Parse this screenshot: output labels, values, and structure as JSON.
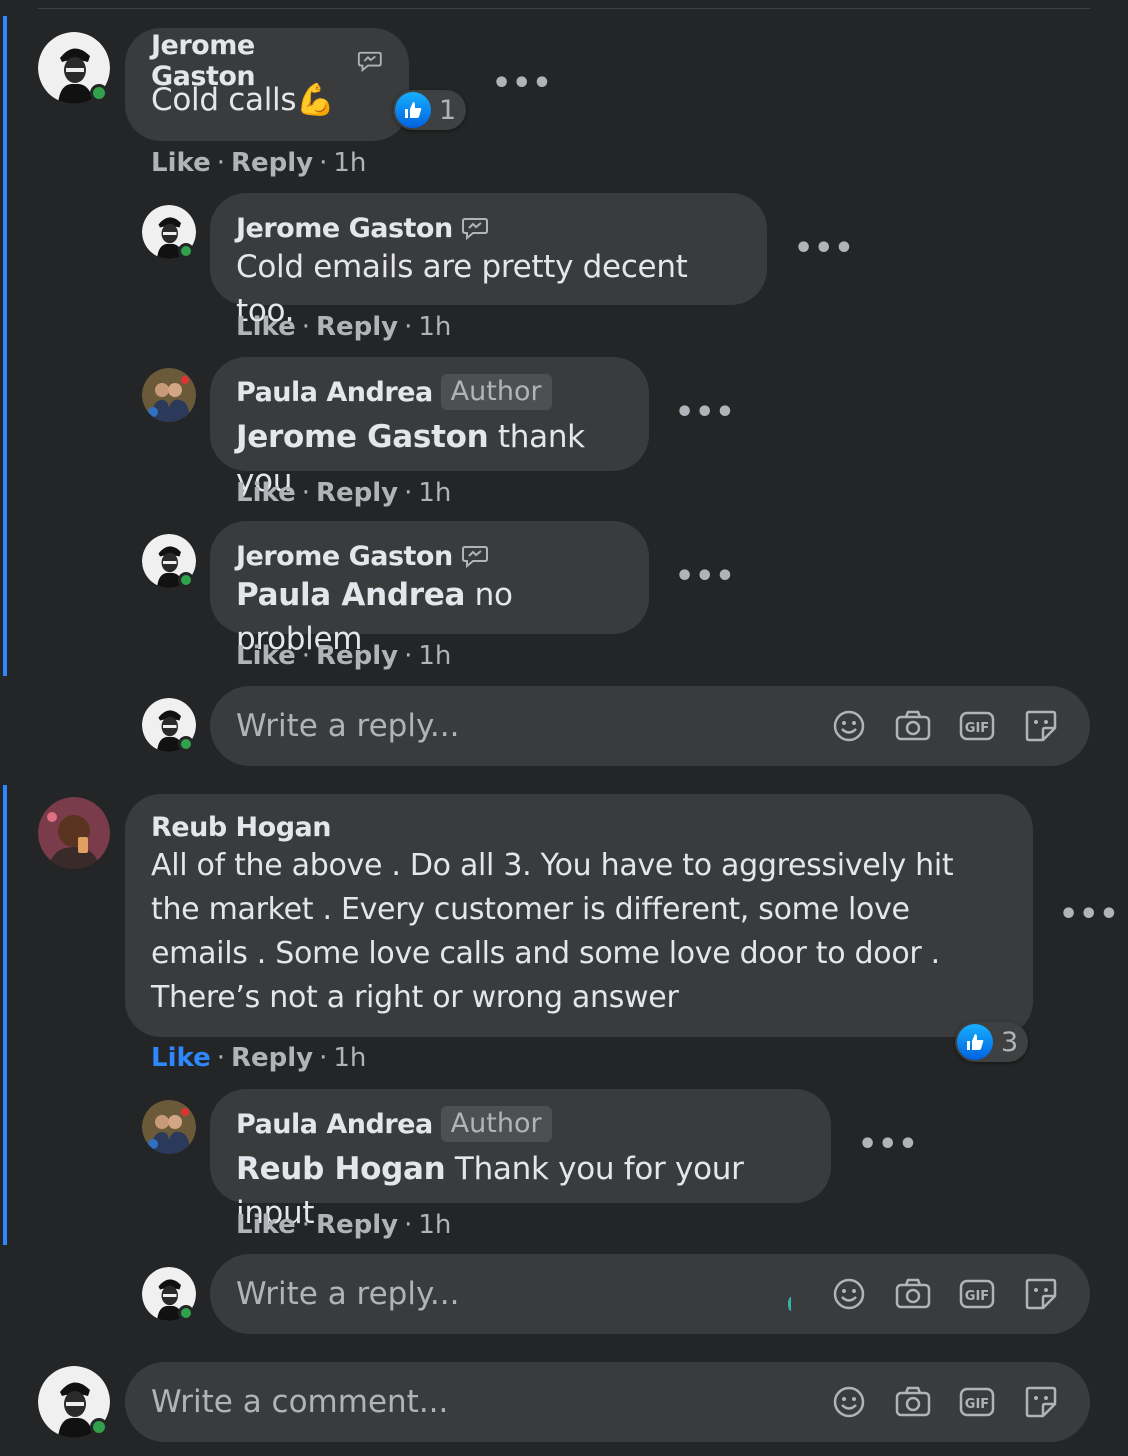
{
  "placeholders": {
    "reply": "Write a reply...",
    "comment": "Write a comment..."
  },
  "actions": {
    "like": "Like",
    "reply": "Reply",
    "sep": "·"
  },
  "author_badge": "Author",
  "comments": {
    "c1": {
      "author": "Jerome Gaston",
      "text": "Cold calls",
      "emoji": "💪",
      "reactions": "1",
      "time": "1h"
    },
    "r1": {
      "author": "Jerome Gaston",
      "text": "Cold emails are pretty decent too.",
      "time": "1h"
    },
    "r2": {
      "author": "Paula Andrea",
      "mention": "Jerome Gaston",
      "text": " thank you",
      "time": "1h"
    },
    "r3": {
      "author": "Jerome Gaston",
      "mention": "Paula Andrea",
      "text": " no problem",
      "time": "1h"
    },
    "c2": {
      "author": "Reub Hogan",
      "text": "All of the above . Do all 3. You have to aggressively hit the market . Every customer is different, some love emails . Some love calls and some love door to door . There’s not a right or wrong answer",
      "reactions": "3",
      "time": "1h",
      "liked": true
    },
    "r4": {
      "author": "Paula Andrea",
      "mention": "Reub Hogan",
      "text": " Thank you for your input",
      "time": "1h"
    }
  },
  "icons": [
    "like-thumb-icon",
    "messenger-chat-icon",
    "emoji-icon",
    "camera-icon",
    "gif-icon",
    "sticker-icon",
    "more-options-icon"
  ],
  "colors": {
    "background": "#242526",
    "bubble": "#3a3b3c",
    "accent": "#2d88ff",
    "online": "#31a24c",
    "muted": "#b0b3b8"
  }
}
